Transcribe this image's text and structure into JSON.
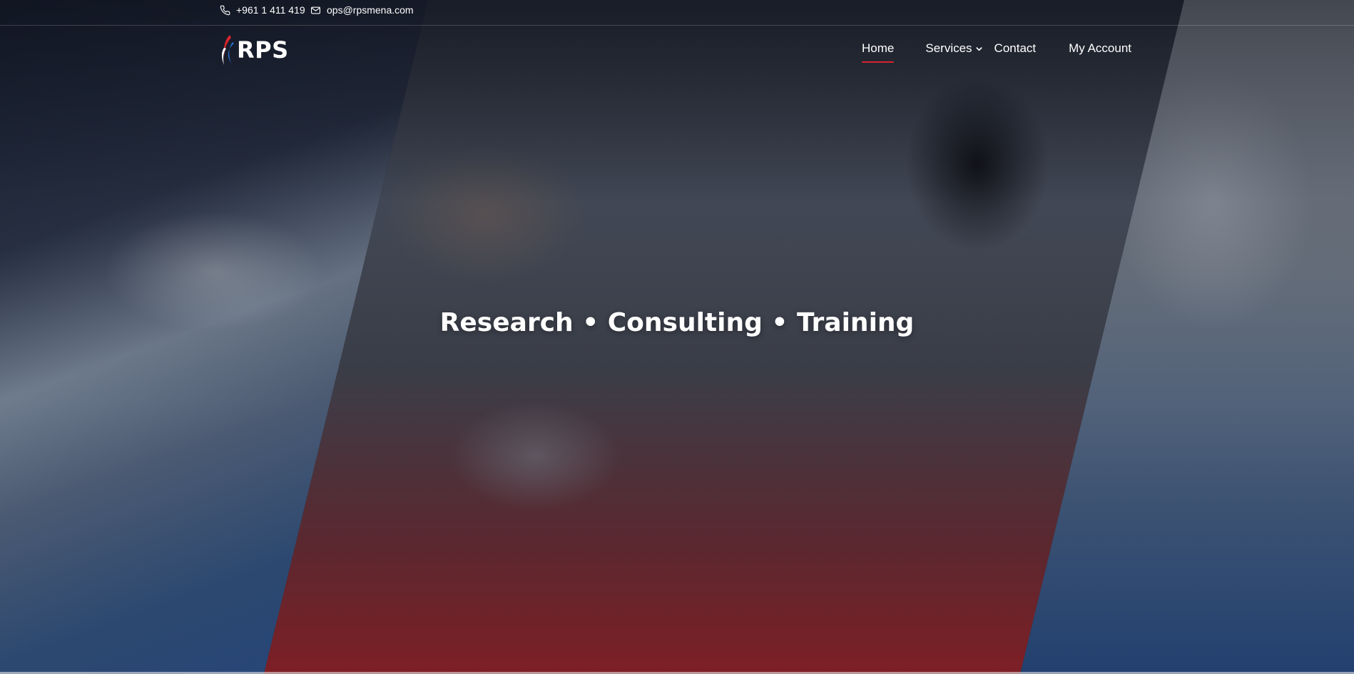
{
  "topbar": {
    "phone": "+961 1 411 419",
    "email": "ops@rpsmena.com"
  },
  "header": {
    "logo_text": "RPS",
    "nav": {
      "home": "Home",
      "services": "Services",
      "contact": "Contact",
      "account": "My Account"
    }
  },
  "hero": {
    "title": "Research • Consulting • Training"
  },
  "colors": {
    "accent": "#d6242e",
    "text": "#ffffff"
  },
  "icons": {
    "phone": "phone-icon",
    "email": "mail-icon",
    "services_dropdown": "chevron-down-icon"
  }
}
